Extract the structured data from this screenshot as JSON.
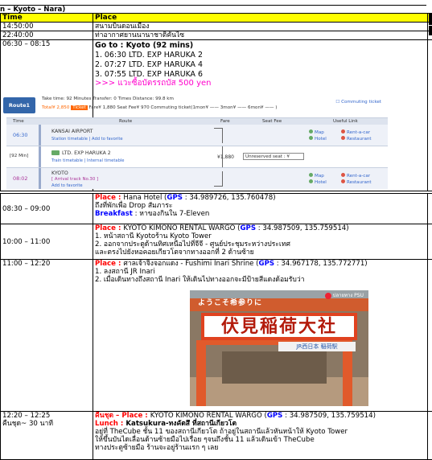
{
  "header_strip": "n – Kyoto – Nara)",
  "columns": {
    "time": "Time",
    "place": "Place"
  },
  "rows": {
    "r1": {
      "time": "14:50:00",
      "place": "สนามบินดอนเมือง"
    },
    "r2": {
      "time": "22:40:00",
      "place": "ท่าอากาศยานนานาชาติคันไซ"
    },
    "r3": {
      "time": "06:30 – 08:15",
      "title": "Go to : Kyoto (92 mins)",
      "trains": [
        "1. 06:30 LTD. EXP HARUKA 2",
        "2. 07:27 LTD. EXP HARUKA 4",
        "3. 07:55 LTD. EXP HARUKA 6"
      ],
      "note": ">>> แวะซื้อบัตรรถบัส 500 yen"
    },
    "r4": {
      "time": "08:30 – 09:00",
      "place_label": "Place : ",
      "place_name": "Hana Hotel (",
      "gps_label": "GPS",
      "gps_value": " : 34.989726, 135.760478)",
      "line2": "ถึงที่พักเพื่อ Drop สัมภาระ",
      "meal_label": "Breakfast",
      "meal_text": " : หาของกินใน 7-Eleven"
    },
    "r5": {
      "time": "10:00 – 11:00",
      "place_label": "Place : ",
      "place_name": "KYOTO KIMONO RENTAL WARGO (",
      "gps_label": "GPS",
      "gps_value": " : 34.987509, 135.759514)",
      "line2": "1. หน้าสถานี Kyotoร้าน Kyoto Tower",
      "line3": "2. ออกจากประตูด้านทิศเหนือไปที่จีจี - ศูนย์ประชุมระหว่างประเทศ",
      "line4": "และตรงไปยังหอคอยเกียวโตจากทางออกที่ 2 ด้านซ้าย"
    },
    "r6": {
      "time": "11:00 – 12:20",
      "place_label": "Place : ",
      "place_name": "ศาลเจ้าจิ้งจอกแดง - Fushimi Inari Shrine (",
      "gps_label": "GPS",
      "gps_value": " : 34.967178, 135.772771)",
      "line2": "1. ลงสถานี JR Inari",
      "line3": "2. เมื่อเดินทางถึงสถานี Inari ให้เดินไปทางออกจะมีป้ายสีแดงด้อมรับว่า"
    },
    "r7": {
      "time": "12:20 – 12:25",
      "time2": "คืนชุด~ 30 นาที",
      "prefix": "คืนชุด – ",
      "place_label": "Place : ",
      "place_name": "KYOTO KIMONO RENTAL WARGO (",
      "gps_label": "GPS",
      "gps_value": " : 34.987509, 135.759514)",
      "lunch_label": "Lunch : ",
      "lunch_text": "Katsukura-ทงคัตสึ ที่สถานีเกียวโต",
      "line3": "อยู่ที่ TheCube ชั้น 11 ของสถานีเกียวโต ถ้าอยู่ในสถานีแล้วหันหน้าให้ Kyoto Tower",
      "line4": "ให้ขึ้นบันไดเลื่อนด้านซ้ายมือไปเรื่อย ๆจนถึงชั้น 11 แล้วเดินเข้า TheCube",
      "line5": "ทางประตูซ้ายมือ ร้านจะอยู่ร้านแรก ๆ เลย"
    }
  },
  "route_card": {
    "tab": "Route1",
    "summary1": "Take time: 92 Minutes  Transfer: 0 Times  Distance: 99.8 km",
    "summary2_total": "Total¥ 2,850",
    "summary2_ticket": "Ticket",
    "summary2_rest": "Fare¥ 1,880  Seat Fee¥ 970  Commuting ticket(1mon¥ ——    3mon¥ ——    6mon¥ —— )",
    "fav_link": "☐ Commuting ticket",
    "col_time": "Time",
    "col_route": "Route",
    "col_fare": "Fare",
    "col_seat": "Seat Fee",
    "col_useful": "Useful Link",
    "dep_time": "06:30",
    "dep_station": "KANSAI AIRPORT",
    "dep_links": "Station timetable | Add to favorite",
    "duration": "[92 Min]",
    "train_name": "LTD. EXP HARUKA 2",
    "train_links": "Train timetable | Internal timetable",
    "fare": "¥1,880",
    "seat_select": "Unreserved seat : ¥",
    "arr_time": "08:02",
    "arr_station": "KYOTO",
    "arr_track": "[ Arrival track No.30 ]",
    "arr_links": "Add to favorite",
    "util_map": "Map",
    "util_hotel": "Hotel",
    "util_rent": "Rent-a-car",
    "util_rest": "Restaurant"
  },
  "photo": {
    "roof_text": "ようこそ希参りに",
    "sign_text": "伏見稲荷大社",
    "sub_text": "JR西日本 稲荷駅",
    "watermark": "ปลายทาง PSU"
  },
  "colors": {
    "header_bg": "#ffff00",
    "place_red": "#ff0000",
    "gps_blue": "#0000ff",
    "note_pink": "#ff00cc",
    "route_tab": "#3366aa"
  }
}
